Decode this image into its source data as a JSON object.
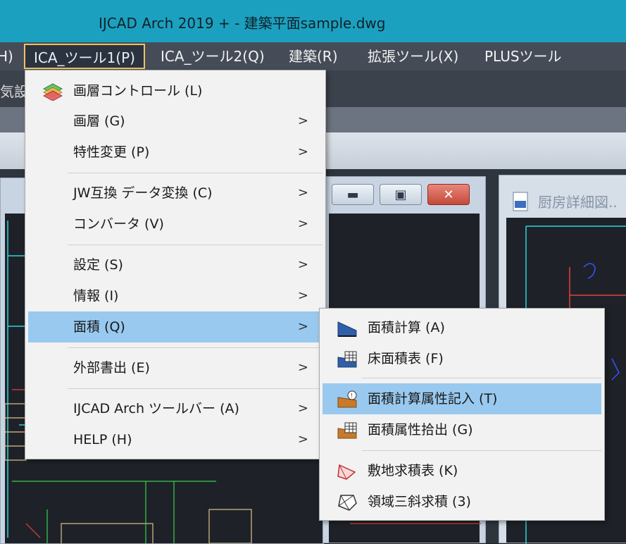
{
  "window": {
    "title": "IJCAD Arch 2019 + - 建築平面sample.dwg"
  },
  "menubar": {
    "partial": "H)",
    "items": [
      {
        "label": "ICA_ツール1(P)"
      },
      {
        "label": "ICA_ツール2(Q)"
      },
      {
        "label": "建築(R)"
      },
      {
        "label": "拡張ツール(X)"
      },
      {
        "label": "PLUSツール"
      }
    ]
  },
  "toolbar_partial": "気設",
  "drawing2": {
    "title": "厨房詳細図.."
  },
  "window_buttons": {
    "minimize": "▬",
    "maximize": "▣",
    "close": "✕"
  },
  "menu": {
    "items": [
      {
        "label": "画層コントロール (L)",
        "icon": "layers-icon"
      },
      {
        "label": "画層 (G)",
        "arrow": ">"
      },
      {
        "label": "特性変更 (P)",
        "arrow": ">"
      },
      {
        "label": "JW互換 データ変換 (C)",
        "arrow": ">"
      },
      {
        "label": "コンバータ (V)",
        "arrow": ">"
      },
      {
        "label": "設定 (S)",
        "arrow": ">"
      },
      {
        "label": "情報 (I)",
        "arrow": ">"
      },
      {
        "label": "面積 (Q)",
        "arrow": ">"
      },
      {
        "label": "外部書出 (E)",
        "arrow": ">"
      },
      {
        "label": "IJCAD Arch ツールバー (A)",
        "arrow": ">"
      },
      {
        "label": "HELP (H)",
        "arrow": ">"
      }
    ]
  },
  "submenu": {
    "items": [
      {
        "label": "面積計算 (A)",
        "icon": "area-calc-icon"
      },
      {
        "label": "床面積表 (F)",
        "icon": "floor-area-table-icon"
      },
      {
        "label": "面積計算属性記入 (T)",
        "icon": "area-attribute-entry-icon"
      },
      {
        "label": "面積属性拾出 (G)",
        "icon": "area-attribute-extract-icon"
      },
      {
        "label": "敷地求積表 (K)",
        "icon": "site-area-table-icon"
      },
      {
        "label": "領域三斜求積 (3)",
        "icon": "triangle-area-icon"
      }
    ]
  },
  "colors": {
    "titlebar": "#1ba1bf",
    "highlight": "#99c9ef",
    "menu_bg": "#f2f2f2"
  }
}
